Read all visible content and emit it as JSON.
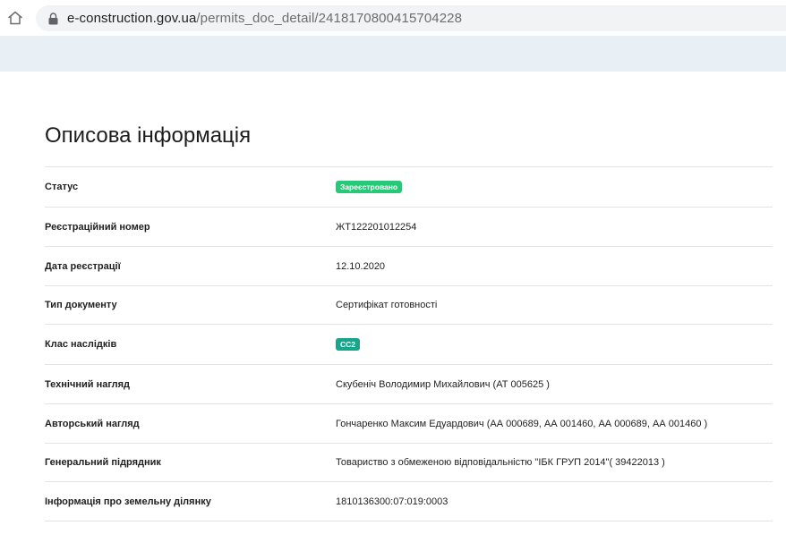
{
  "browser": {
    "url_domain": "e-construction.gov.ua",
    "url_path": "/permits_doc_detail/2418170800415704228",
    "home_icon": "home-icon",
    "lock_icon": "lock-icon"
  },
  "page": {
    "title": "Описова інформація"
  },
  "colors": {
    "header_band": "#e8eff5",
    "status_badge": "#27c878",
    "class_badge": "#17a58c"
  },
  "rows": [
    {
      "label": "Статус",
      "value": "Зареєстровано",
      "type": "badge"
    },
    {
      "label": "Реєстраційний номер",
      "value": "ЖТ122201012254",
      "type": "text"
    },
    {
      "label": "Дата реєстрації",
      "value": "12.10.2020",
      "type": "text"
    },
    {
      "label": "Тип документу",
      "value": "Сертифікат готовності",
      "type": "text"
    },
    {
      "label": "Клас наслідків",
      "value": "СС2",
      "type": "badge"
    },
    {
      "label": "Технічний нагляд",
      "value": "Скубеніч Володимир Михайлович (АТ 005625 )",
      "type": "text"
    },
    {
      "label": "Авторський нагляд",
      "value": "Гончаренко Максим Едуардович (АА 000689, АА 001460, АА 000689, АА 001460 )",
      "type": "text"
    },
    {
      "label": "Генеральний підрядник",
      "value": "Товариство з обмеженою відповідальністю \"ІБК ГРУП 2014\"( 39422013 )",
      "type": "text"
    },
    {
      "label": "Інформація про земельну ділянку",
      "value": "1810136300:07:019:0003",
      "type": "text"
    }
  ]
}
